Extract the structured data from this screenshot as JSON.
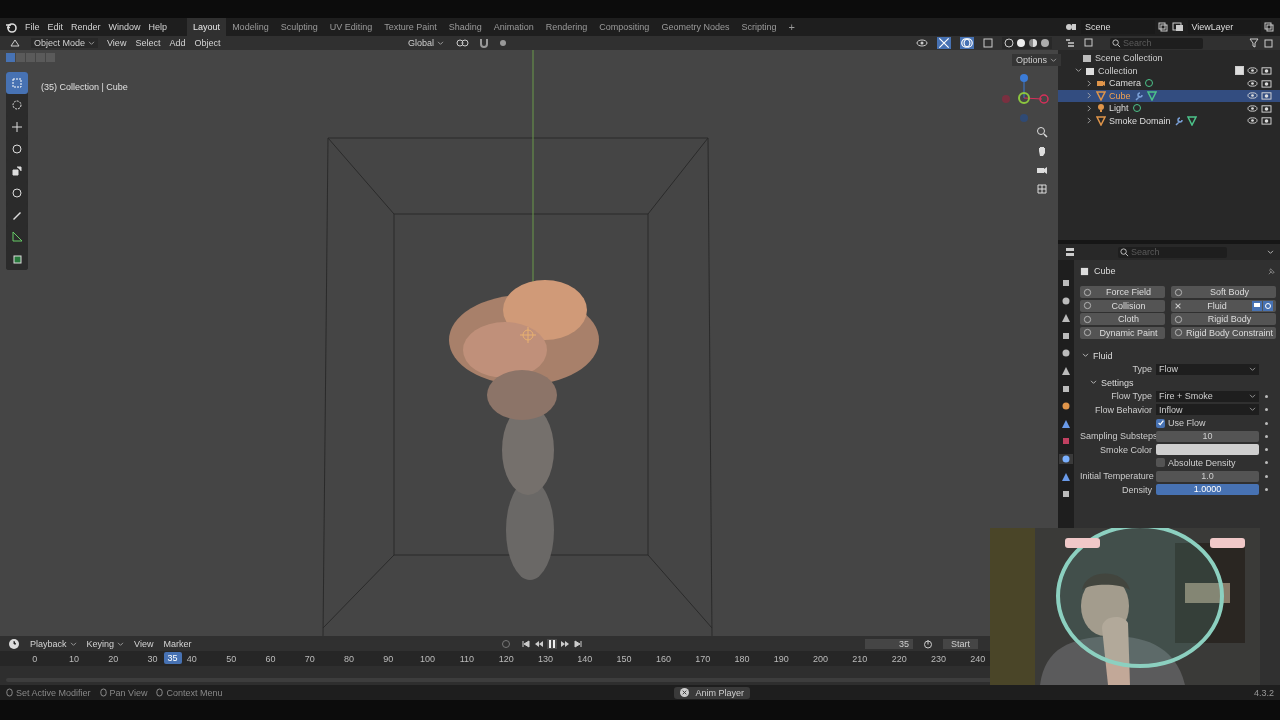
{
  "menu": [
    "File",
    "Edit",
    "Render",
    "Window",
    "Help"
  ],
  "workspaces": [
    {
      "label": "Layout",
      "selected": true
    },
    {
      "label": "Modeling",
      "selected": false
    },
    {
      "label": "Sculpting",
      "selected": false
    },
    {
      "label": "UV Editing",
      "selected": false
    },
    {
      "label": "Texture Paint",
      "selected": false
    },
    {
      "label": "Shading",
      "selected": false
    },
    {
      "label": "Animation",
      "selected": false
    },
    {
      "label": "Rendering",
      "selected": false
    },
    {
      "label": "Compositing",
      "selected": false
    },
    {
      "label": "Geometry Nodes",
      "selected": false
    },
    {
      "label": "Scripting",
      "selected": false
    }
  ],
  "add_workspace": "+",
  "scene": "Scene",
  "view_layer": "ViewLayer",
  "viewport": {
    "mode": "Object Mode",
    "menus": [
      "View",
      "Select",
      "Add",
      "Object"
    ],
    "orientation": "Global",
    "info": "(35) Collection | Cube",
    "options": "Options",
    "select_modes": [
      {
        "selected": true
      },
      {
        "selected": false
      },
      {
        "selected": false
      },
      {
        "selected": false
      },
      {
        "selected": false
      }
    ],
    "tools": [
      {
        "selected": true
      },
      {
        "selected": false
      },
      {
        "selected": false
      },
      {
        "selected": false
      },
      {
        "selected": false
      },
      {
        "selected": false
      },
      {
        "selected": false
      },
      {
        "selected": false
      },
      {
        "selected": false
      }
    ]
  },
  "outliner": {
    "search_placeholder": "Search",
    "root": "Scene Collection",
    "items": [
      {
        "label": "Collection",
        "expanded": true,
        "checked": true,
        "children": [
          {
            "label": "Camera",
            "kind": "camera",
            "selected": false,
            "expanded": false
          },
          {
            "label": "Cube",
            "kind": "mesh",
            "selected": true,
            "expanded": false
          },
          {
            "label": "Light",
            "kind": "light",
            "selected": false,
            "expanded": false
          },
          {
            "label": "Smoke Domain",
            "kind": "mesh",
            "selected": false,
            "expanded": false
          }
        ]
      }
    ]
  },
  "properties": {
    "search_placeholder": "Search",
    "object": "Cube",
    "tabs": [
      {
        "selected": false
      },
      {
        "selected": false
      },
      {
        "selected": false
      },
      {
        "selected": false
      },
      {
        "selected": false
      },
      {
        "selected": false
      },
      {
        "selected": false
      },
      {
        "selected": false
      },
      {
        "selected": false
      },
      {
        "selected": false
      },
      {
        "selected": true
      },
      {
        "selected": false
      },
      {
        "selected": false
      }
    ],
    "physics": [
      {
        "label": "Force Field",
        "enabled": false
      },
      {
        "label": "Soft Body",
        "enabled": false
      },
      {
        "label": "Collision",
        "enabled": false
      },
      {
        "label": "Fluid",
        "enabled": true
      },
      {
        "label": "Cloth",
        "enabled": false
      },
      {
        "label": "Rigid Body",
        "enabled": false
      },
      {
        "label": "Dynamic Paint",
        "enabled": false
      },
      {
        "label": "Rigid Body Constraint",
        "enabled": false
      }
    ],
    "panel": "Fluid",
    "type_label": "Type",
    "type": "Flow",
    "subpanel": "Settings",
    "fields": [
      {
        "kind": "dropdown",
        "label": "Flow Type",
        "value": "Fire + Smoke"
      },
      {
        "kind": "dropdown",
        "label": "Flow Behavior",
        "value": "Inflow"
      },
      {
        "kind": "checkbox",
        "label": "Use Flow",
        "checked": true
      },
      {
        "kind": "number",
        "label": "Sampling Substeps",
        "value": "10",
        "selected": false
      },
      {
        "kind": "color",
        "label": "Smoke Color"
      },
      {
        "kind": "checkbox",
        "label": "Absolute Density",
        "checked": false
      },
      {
        "kind": "number",
        "label": "Initial Temperature",
        "value": "1.0",
        "selected": false
      },
      {
        "kind": "number",
        "label": "Density",
        "value": "1.0000",
        "selected": true
      }
    ]
  },
  "timeline": {
    "menus": [
      "Playback",
      "Keying",
      "View",
      "Marker"
    ],
    "playing": true,
    "current_frame": "35",
    "frame_field": "35",
    "start_label": "Start",
    "ticks": [
      "0",
      "10",
      "20",
      "30",
      "40",
      "50",
      "60",
      "70",
      "80",
      "90",
      "100",
      "110",
      "120",
      "130",
      "140",
      "150",
      "160",
      "170",
      "180",
      "190",
      "200",
      "210",
      "220",
      "230",
      "240"
    ]
  },
  "status_bar": {
    "hints": [
      "Set Active Modifier",
      "Pan View",
      "Context Menu"
    ],
    "notice": "Anim Player",
    "version": "4.3.2"
  }
}
